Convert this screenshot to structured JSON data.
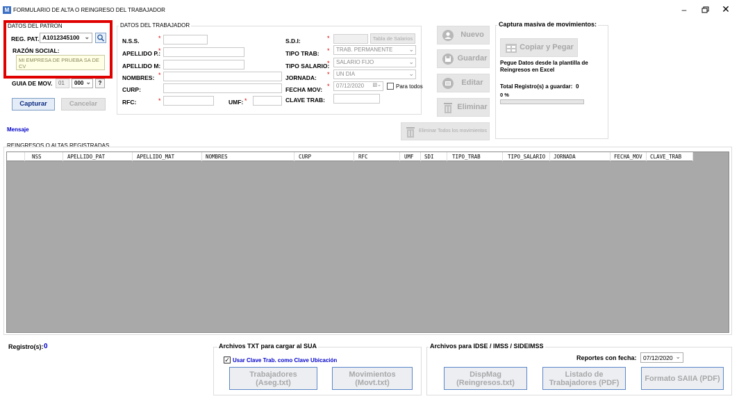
{
  "window": {
    "title": "FORMULARIO DE ALTA O REINGRESO DEL TRABAJADOR",
    "app_icon": "M"
  },
  "patron": {
    "group_title": "DATOS DEL PATRON",
    "reg_pat_label": "REG. PAT.",
    "reg_pat_value": "A1012345100",
    "razon_label": "RAZÓN SOCIAL:",
    "razon_value": "MI EMPRESA DE PRUEBA SA DE CV",
    "guia_label": "GUIA DE MOV.",
    "guia_value1": "01",
    "guia_value2": "000",
    "help_label": "?",
    "capturar_label": "Capturar",
    "cancelar_label": "Cancelar",
    "highlight_color": "#e00000"
  },
  "trabajador": {
    "group_title": "DATOS DEL TRABAJADOR",
    "nss_label": "N.S.S.",
    "apellido_p_label": "APELLIDO P.:",
    "apellido_m_label": "APELLIDO M:",
    "nombres_label": "NOMBRES:",
    "curp_label": "CURP:",
    "rfc_label": "RFC:",
    "umf_label": "UMF:",
    "sdi_label": "S.D.I:",
    "tabla_salarios_label": "Tabla de Salarios",
    "tipo_trab_label": "TIPO TRAB:",
    "tipo_trab_value": "TRAB. PERMANENTE",
    "tipo_salario_label": "TIPO SALARIO:",
    "tipo_salario_value": "SALARIO FIJO",
    "jornada_label": "JORNADA:",
    "jornada_value": "UN DIA",
    "fecha_mov_label": "FECHA MOV:",
    "fecha_mov_value": "07/12/2020",
    "para_todos_label": "Para todos",
    "clave_trab_label": "CLAVE TRAB:",
    "required_mark": "*"
  },
  "actions": {
    "nuevo_label": "Nuevo",
    "guardar_label": "Guardar",
    "editar_label": "Editar",
    "eliminar_label": "Eliminar",
    "eliminar_todos_label": "Eliminar Todos los movimientos"
  },
  "captura": {
    "title": "Captura masiva de movimientos:",
    "copiar_label": "Copiar y Pegar",
    "instruction": "Pegue Datos desde la plantilla de Reingresos en Excel",
    "total_label": "Total Registro(s) a guardar:",
    "total_value": "0",
    "percent": "0 %",
    "progress": 0
  },
  "mensaje_label": "Mensaje",
  "table": {
    "title": "REINGRESOS O ALTAS REGISTRADAS",
    "columns": [
      "NSS",
      "APELLIDO_PAT",
      "APELLIDO_MAT",
      "NOMBRES",
      "CURP",
      "RFC",
      "UMF",
      "SDI",
      "TIPO_TRAB",
      "TIPO_SALARIO",
      "JORNADA",
      "FECHA_MOV",
      "CLAVE_TRAB"
    ],
    "rows": []
  },
  "footer": {
    "registros_label": "Registro(s):",
    "registros_value": "0",
    "sua_title": "Archivos  TXT para cargar al SUA",
    "usar_clave_label": "Usar Clave Trab. como Clave Ubicación",
    "trabajadores_label": "Trabajadores (Aseg.txt)",
    "movimientos_label": "Movimientos (Movt.txt)",
    "idse_title": "Archivos para IDSE / IMSS / SIDEIMSS",
    "reportes_label": "Reportes con fecha:",
    "reportes_value": "07/12/2020",
    "dispmag_label": "DispMag (Reingresos.txt)",
    "listado_label": "Listado de Trabajadores (PDF)",
    "formato_label": "Formato SAIIA (PDF)"
  },
  "colors": {
    "accent": "#0000c8",
    "grid_bg": "#a9a9a9",
    "disabled_text": "#a8a8a8"
  }
}
